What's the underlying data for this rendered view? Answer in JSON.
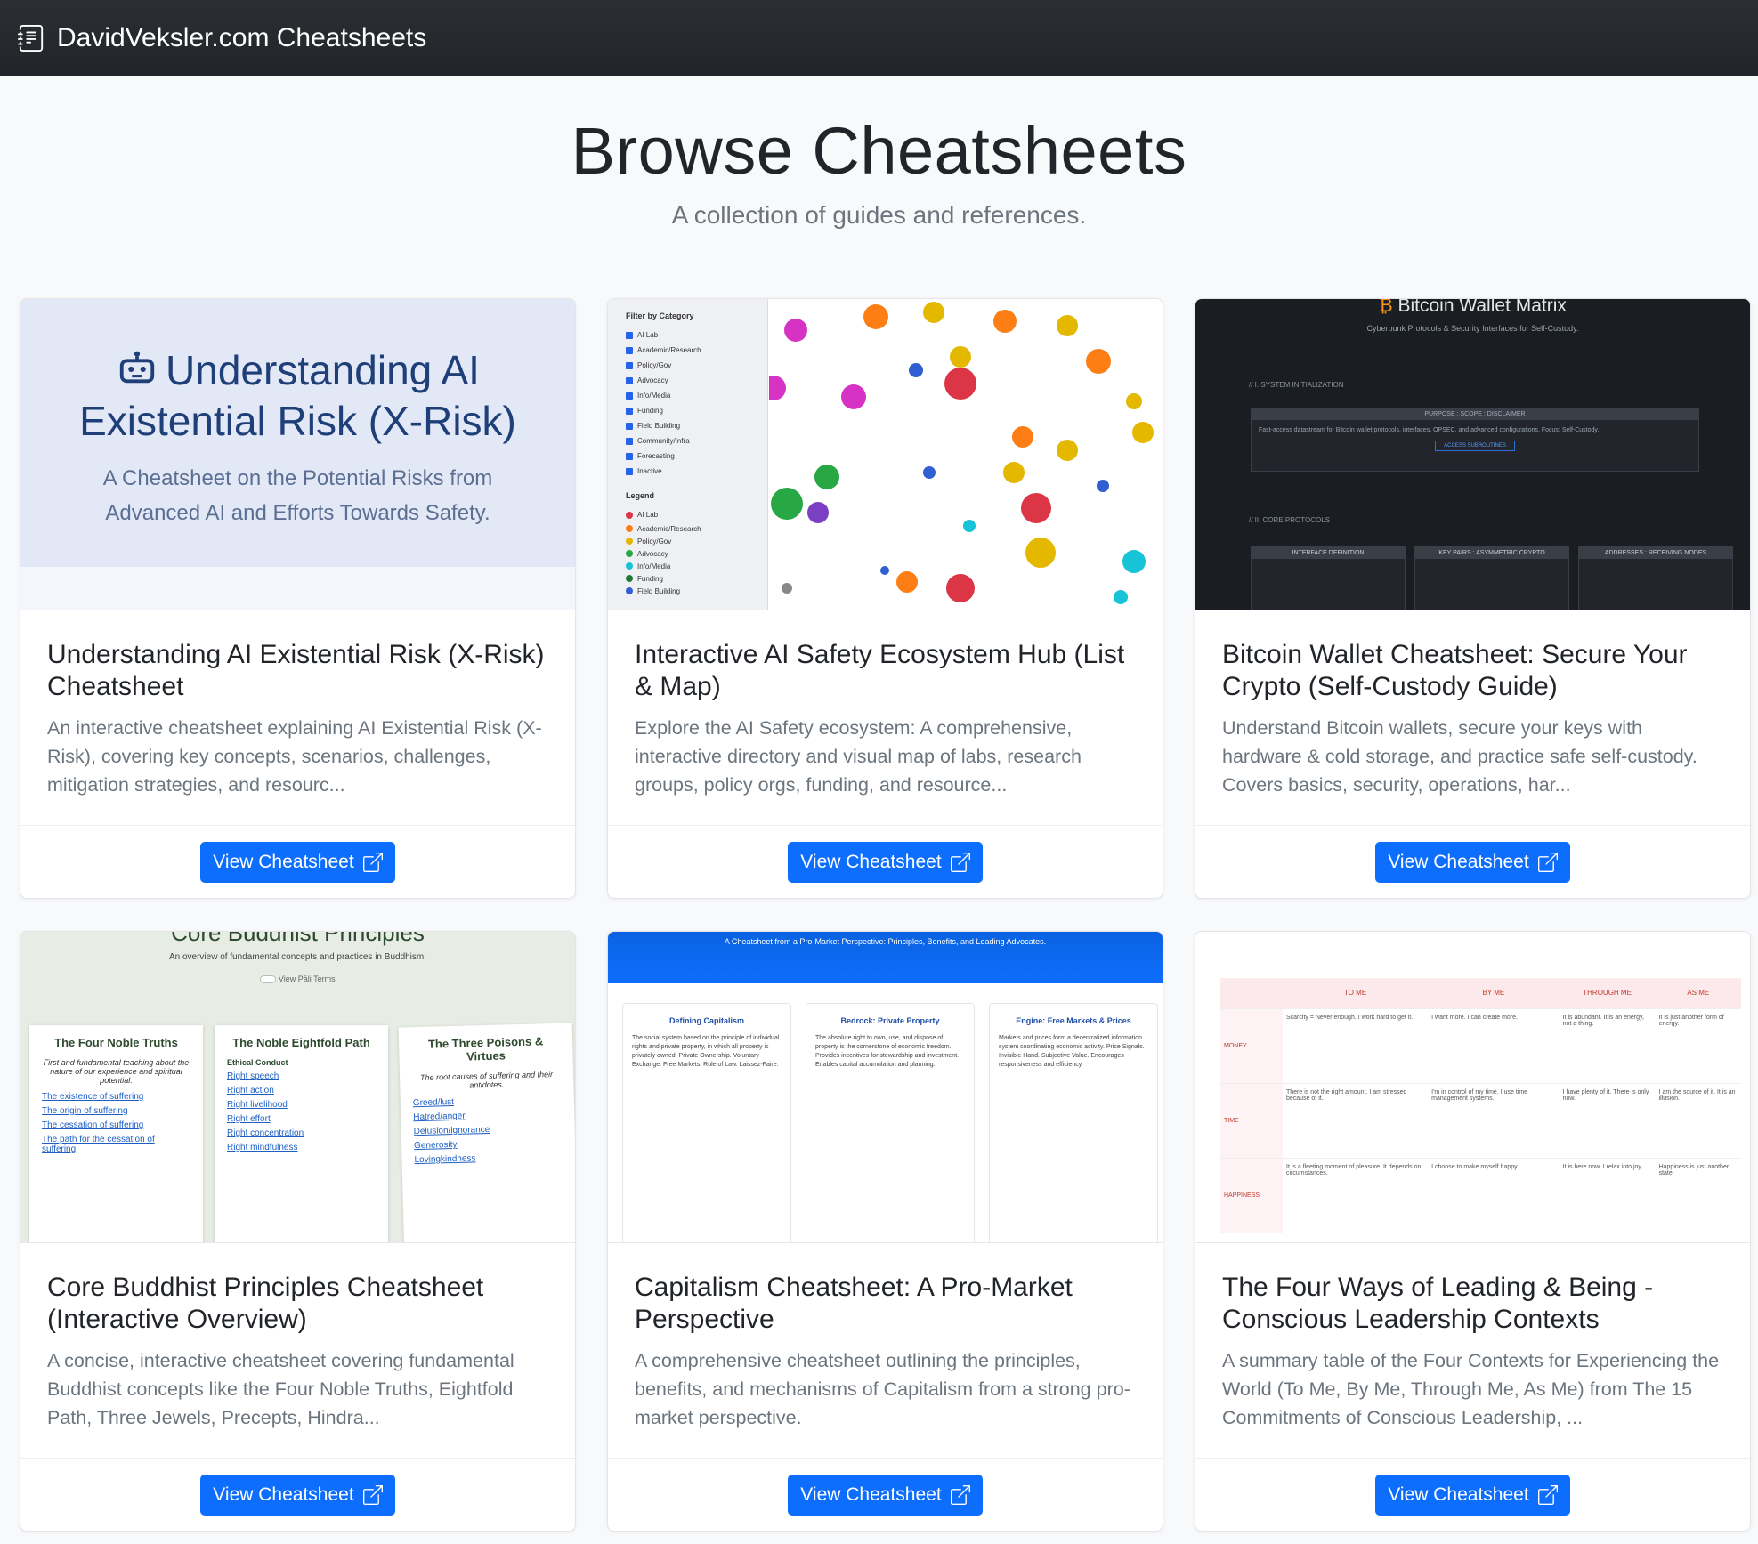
{
  "navbar": {
    "brand": "DavidVeksler.com Cheatsheets",
    "icon": "journal-text-icon"
  },
  "hero": {
    "title": "Browse Cheatsheets",
    "subtitle": "A collection of guides and references."
  },
  "button_label": "View Cheatsheet",
  "cards": [
    {
      "title": "Understanding AI Existential Risk (X-Risk) Cheatsheet",
      "text": "An interactive cheatsheet explaining AI Existential Risk (X-Risk), covering key concepts, scenarios, challenges, mitigation strategies, and resourc...",
      "thumb": {
        "heading": "Understanding AI Existential Risk (X-Risk)",
        "subheading": "A Cheatsheet on the Potential Risks from Advanced AI and Efforts Towards Safety."
      }
    },
    {
      "title": "Interactive AI Safety Ecosystem Hub (List & Map)",
      "text": "Explore the AI Safety ecosystem: A comprehensive, interactive directory and visual map of labs, research groups, policy orgs, funding, and resource...",
      "thumb": {
        "filter_title": "Filter by Category",
        "filters": [
          "AI Lab",
          "Academic/Research",
          "Policy/Gov",
          "Advocacy",
          "Info/Media",
          "Funding",
          "Field Building",
          "Community/Infra",
          "Forecasting",
          "Inactive"
        ],
        "legend_title": "Legend",
        "legend": [
          {
            "label": "AI Lab",
            "color": "#dc3545"
          },
          {
            "label": "Academic/Research",
            "color": "#fd7e14"
          },
          {
            "label": "Policy/Gov",
            "color": "#e5b800"
          },
          {
            "label": "Advocacy",
            "color": "#28a745"
          },
          {
            "label": "Info/Media",
            "color": "#17c3d6"
          },
          {
            "label": "Funding",
            "color": "#1f7a3a"
          },
          {
            "label": "Field Building",
            "color": "#2f5fd1"
          }
        ]
      }
    },
    {
      "title": "Bitcoin Wallet Cheatsheet: Secure Your Crypto (Self-Custody Guide)",
      "text": "Understand Bitcoin wallets, secure your keys with hardware & cold storage, and practice safe self-custody. Covers basics, security, operations, har...",
      "thumb": {
        "heading": "Bitcoin Wallet Matrix",
        "subheading": "Cyberpunk Protocols & Security Interfaces for Self-Custody.",
        "section1": "// I. SYSTEM INITIALIZATION",
        "panel_title": "PURPOSE : SCOPE : DISCLAIMER",
        "panel_text": "Fast-access datastream for Bitcoin wallet protocols, interfaces, OPSEC, and advanced configurations. Focus: Self-Custody.",
        "panel_button": "ACCESS SUBROUTINES",
        "section2": "// II. CORE PROTOCOLS",
        "boxes": [
          "INTERFACE DEFINITION",
          "KEY PAIRS : ASYMMETRIC CRYPTO",
          "ADDRESSES : RECEIVING NODES"
        ]
      }
    },
    {
      "title": "Core Buddhist Principles Cheatsheet (Interactive Overview)",
      "text": "A concise, interactive cheatsheet covering fundamental Buddhist concepts like the Four Noble Truths, Eightfold Path, Three Jewels, Precepts, Hindra...",
      "thumb": {
        "heading": "Core Buddhist Principles",
        "subheading": "An overview of fundamental concepts and practices in Buddhism.",
        "toggle": "View Pāli Terms",
        "panes": [
          {
            "title": "The Four Noble Truths",
            "intro": "First and fundamental teaching about the nature of our experience and spiritual potential.",
            "items": [
              "The existence of suffering",
              "The origin of suffering",
              "The cessation of suffering",
              "The path for the cessation of suffering"
            ]
          },
          {
            "title": "The Noble Eightfold Path",
            "intro": "Ethical Conduct",
            "items": [
              "Right speech",
              "Right action",
              "Right livelihood",
              "Right effort",
              "Right concentration",
              "Right mindfulness"
            ]
          },
          {
            "title": "The Three Poisons & Virtues",
            "intro": "The root causes of suffering and their antidotes.",
            "items": [
              "Greed/lust",
              "Hatred/anger",
              "Delusion/ignorance",
              "Generosity",
              "Lovingkindness"
            ]
          }
        ]
      }
    },
    {
      "title": "Capitalism Cheatsheet: A Pro-Market Perspective",
      "text": "A comprehensive cheatsheet outlining the principles, benefits, and mechanisms of Capitalism from a strong pro-market perspective.",
      "thumb": {
        "banner": "A Cheatsheet from a Pro-Market Perspective: Principles, Benefits, and Leading Advocates.",
        "columns": [
          {
            "title": "Defining Capitalism",
            "text": "The social system based on the principle of individual rights and private property, in which all property is privately owned. Private Ownership. Voluntary Exchange. Free Markets. Rule of Law. Laissez-Faire."
          },
          {
            "title": "Bedrock: Private Property",
            "text": "The absolute right to own, use, and dispose of property is the cornerstone of economic freedom. Provides incentives for stewardship and investment. Enables capital accumulation and planning."
          },
          {
            "title": "Engine: Free Markets & Prices",
            "text": "Markets and prices form a decentralized information system coordinating economic activity. Price Signals. Invisible Hand. Subjective Value. Encourages responsiveness and efficiency."
          }
        ]
      }
    },
    {
      "title": "The Four Ways of Leading & Being - Conscious Leadership Contexts",
      "text": "A summary table of the Four Contexts for Experiencing the World (To Me, By Me, Through Me, As Me) from The 15 Commitments of Conscious Leadership, ...",
      "thumb": {
        "columns": [
          "TO ME",
          "BY ME",
          "THROUGH ME",
          "AS ME"
        ],
        "rows": [
          {
            "label": "MONEY",
            "cells": [
              "Scarcity = Never enough. I work hard to get it.",
              "I want more. I can create more.",
              "It is abundant. It is an energy, not a thing.",
              "It is just another form of energy."
            ]
          },
          {
            "label": "TIME",
            "cells": [
              "There is not the right amount. I am stressed because of it.",
              "I'm in control of my time. I use time management systems.",
              "I have plenty of it. There is only now.",
              "I am the source of it. It is an illusion."
            ]
          },
          {
            "label": "HAPPINESS",
            "cells": [
              "It is a fleeting moment of pleasure. It depends on circumstances.",
              "I choose to make myself happy.",
              "It is here now. I relax into joy.",
              "Happiness is just another state."
            ]
          }
        ]
      }
    }
  ]
}
